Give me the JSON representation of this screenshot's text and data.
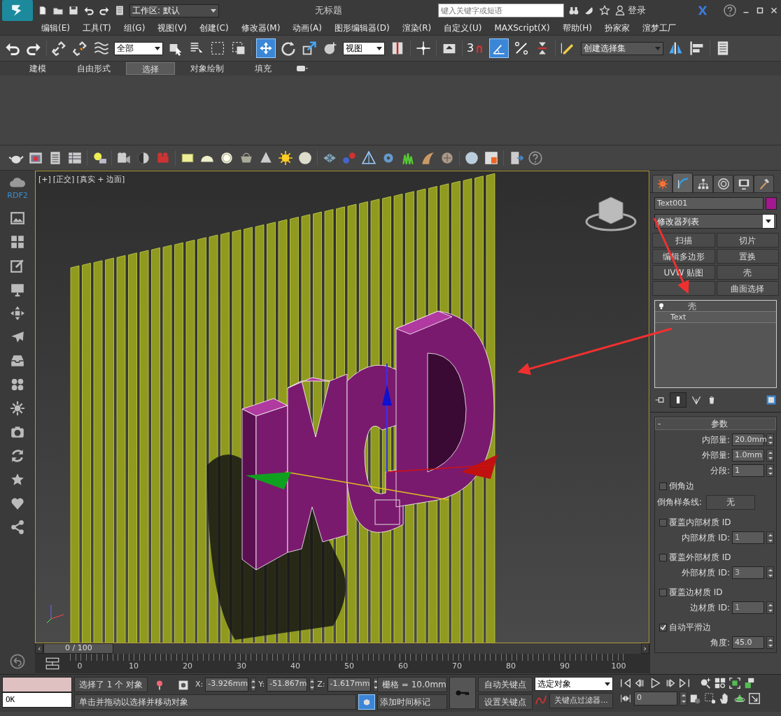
{
  "title_bar": {
    "workspace": "工作区: 默认",
    "title": "无标题",
    "search_placeholder": "键入关键字或短语",
    "login": "登录"
  },
  "menu": [
    "编辑(E)",
    "工具(T)",
    "组(G)",
    "视图(V)",
    "创建(C)",
    "修改器(M)",
    "动画(A)",
    "图形编辑器(D)",
    "渲染(R)",
    "自定义(U)",
    "MAXScript(X)",
    "帮助(H)",
    "扮家家",
    "渲梦工厂"
  ],
  "main_toolbar": {
    "selection_filter": "全部",
    "reference_coord": "视图",
    "named_selection": "创建选择集",
    "snap_count": "3"
  },
  "ribbon_tabs": [
    {
      "label": "建模",
      "selected": false
    },
    {
      "label": "自由形式",
      "selected": false
    },
    {
      "label": "选择",
      "selected": true
    },
    {
      "label": "对象绘制",
      "selected": false
    },
    {
      "label": "填充",
      "selected": false
    }
  ],
  "sidebar": {
    "logo_label": "RDF2"
  },
  "viewport": {
    "labels": [
      "[+]",
      "[正交]",
      "[真实 + 边面]"
    ]
  },
  "command_panel": {
    "tabs": [
      {
        "selected": false
      },
      {
        "selected": true
      },
      {
        "selected": false
      },
      {
        "selected": false
      },
      {
        "selected": false
      },
      {
        "selected": false
      }
    ],
    "object_name": "Text001",
    "modifier_list": "修改器列表",
    "modifier_buttons": [
      {
        "label": "扫描"
      },
      {
        "label": "切片"
      },
      {
        "label": "编辑多边形"
      },
      {
        "label": "置换"
      },
      {
        "label": "UVW 贴图"
      },
      {
        "label": "壳"
      },
      {
        "kind": "blank"
      },
      {
        "label": "曲面选择"
      }
    ],
    "stack": [
      {
        "kind": "modifier",
        "label": "壳"
      },
      {
        "kind": "base",
        "label": "Text"
      }
    ],
    "rollout": {
      "collapse_sign": "-",
      "title": "参数",
      "params": [
        {
          "kind": "spinner",
          "label": "内部量:",
          "value": "20.0mm",
          "disabled": false
        },
        {
          "kind": "spinner",
          "label": "外部量:",
          "value": "1.0mm",
          "disabled": false
        },
        {
          "kind": "spinner",
          "label": "分段:",
          "value": "1",
          "disabled": false
        },
        {
          "kind": "checkbox",
          "label": "倒角边",
          "checked": false
        },
        {
          "kind": "button",
          "label": "倒角样条线:",
          "value": "无"
        },
        {
          "kind": "checkbox",
          "label": "覆盖内部材质 ID",
          "checked": false
        },
        {
          "kind": "spinner",
          "label": "内部材质 ID:",
          "value": "1",
          "disabled": true
        },
        {
          "kind": "checkbox",
          "label": "覆盖外部材质 ID",
          "checked": false
        },
        {
          "kind": "spinner",
          "label": "外部材质 ID:",
          "value": "3",
          "disabled": true
        },
        {
          "kind": "checkbox",
          "label": "覆盖边材质 ID",
          "checked": false
        },
        {
          "kind": "spinner",
          "label": "边材质 ID:",
          "value": "1",
          "disabled": true
        },
        {
          "kind": "checkbox",
          "label": "自动平滑边",
          "checked": true
        },
        {
          "kind": "spinner",
          "label": "角度:",
          "value": "45.0",
          "disabled": false
        }
      ]
    }
  },
  "timeline": {
    "prev": "‹",
    "slider": "0 / 100",
    "next": "›",
    "ticks": [
      "0",
      "10",
      "20",
      "30",
      "40",
      "50",
      "60",
      "70",
      "80",
      "90",
      "100"
    ]
  },
  "status": {
    "listener_result": "OK",
    "selection": "选择了 1 个 对象",
    "x_label": "X:",
    "x": "-3.926mm",
    "y_label": "Y:",
    "y": "-51.867m",
    "z_label": "Z:",
    "z": "-1.617mm",
    "grid": "栅格 = 10.0mm",
    "prompt": "单击并拖动以选择并移动对象",
    "add_time_tag": "添加时间标记",
    "auto_key": "自动关键点",
    "set_key": "设置关键点",
    "key_mode": "选定对象",
    "key_filters": "关键点过滤器...",
    "frame": "0"
  }
}
